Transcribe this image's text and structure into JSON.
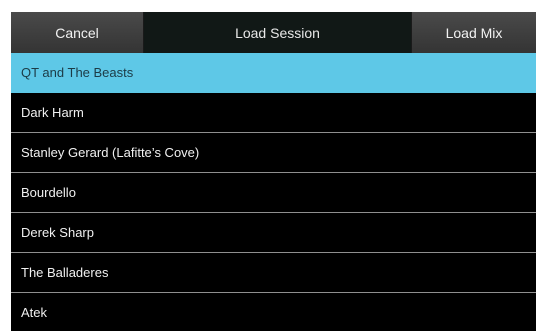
{
  "topbar": {
    "cancel_label": "Cancel",
    "title": "Load Session",
    "load_mix_label": "Load Mix"
  },
  "sessions": [
    {
      "label": "QT and The Beasts",
      "selected": true
    },
    {
      "label": "Dark Harm",
      "selected": false
    },
    {
      "label": "Stanley Gerard (Lafitte’s Cove)",
      "selected": false
    },
    {
      "label": "Bourdello",
      "selected": false
    },
    {
      "label": "Derek Sharp",
      "selected": false
    },
    {
      "label": "The Balladeres",
      "selected": false
    },
    {
      "label": "Atek",
      "selected": false
    }
  ],
  "colors": {
    "selected": "#5ec8e7",
    "background": "#000000",
    "button": "#3f3f3f"
  }
}
